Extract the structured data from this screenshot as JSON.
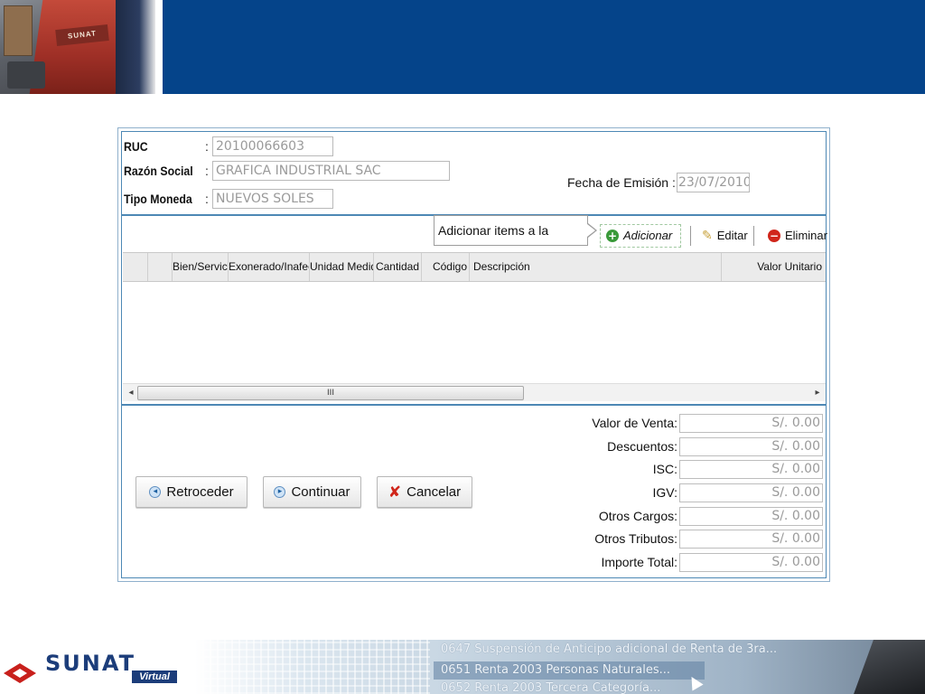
{
  "header": {
    "photo_logo_text": "SUNAT",
    "bar_color": "#05448a"
  },
  "form": {
    "ruc": {
      "label": "RUC",
      "value": "20100066603"
    },
    "razon_social": {
      "label": "Razón Social",
      "value": "GRAFICA INDUSTRIAL SAC"
    },
    "tipo_moneda": {
      "label": "Tipo Moneda",
      "value": "NUEVOS SOLES"
    },
    "fecha_emision": {
      "label": "Fecha de Emisión",
      "value": "23/07/2010"
    },
    "colon": ":"
  },
  "toolbar": {
    "tooltip": "Adicionar items a la factura.",
    "adicionar": "Adicionar",
    "editar": "Editar",
    "eliminar": "Eliminar"
  },
  "grid": {
    "columns": [
      "",
      "",
      "Bien/Servicio",
      "Exonerado/Inafecto",
      "Unidad Medida",
      "Cantidad",
      "Código",
      "Descripción",
      "Valor Unitario"
    ],
    "rows": [],
    "scroll_thumb_label": "III"
  },
  "buttons": {
    "retroceder": "Retroceder",
    "continuar": "Continuar",
    "cancelar": "Cancelar"
  },
  "totals": [
    {
      "label": "Valor de Venta:",
      "value": "S/. 0.00"
    },
    {
      "label": "Descuentos:",
      "value": "S/. 0.00"
    },
    {
      "label": "ISC:",
      "value": "S/. 0.00"
    },
    {
      "label": "IGV:",
      "value": "S/. 0.00"
    },
    {
      "label": "Otros Cargos:",
      "value": "S/. 0.00"
    },
    {
      "label": "Otros Tributos:",
      "value": "S/. 0.00"
    },
    {
      "label": "Importe Total:",
      "value": "S/. 0.00"
    }
  ],
  "footer": {
    "logo_text": "SUNAT",
    "logo_sub": "Virtual",
    "banner_lines": [
      "0647 Suspensión de Anticipo adicional de Renta de 3ra...",
      "0651 Renta 2003 Personas Naturales...",
      "0652 Renta 2003 Tercera Categoría..."
    ]
  },
  "icons": {
    "adicionar": "plus-circle-icon",
    "editar": "pencil-icon",
    "eliminar": "minus-circle-icon",
    "retroceder": "back-arrow-icon",
    "continuar": "forward-arrow-icon",
    "cancelar": "red-x-icon"
  },
  "colors": {
    "brand_blue": "#05448a",
    "border_blue": "#4d88b5",
    "add_green": "#3a9a3a",
    "delete_red": "#d0261b"
  }
}
